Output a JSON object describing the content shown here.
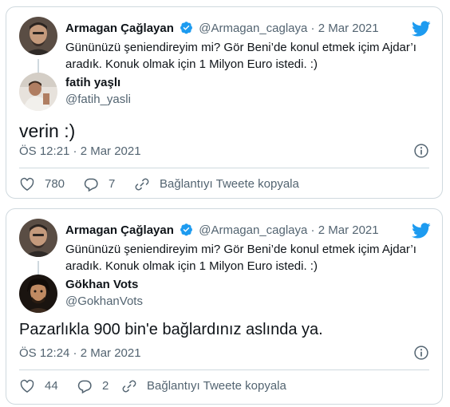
{
  "tweets": [
    {
      "original": {
        "name": "Armagan Çağlayan",
        "handle": "@Armagan_caglaya",
        "sep": "·",
        "date": "2 Mar 2021",
        "text": "Gününüzü şeniendireyim mi? Gör Beni’de konul etmek içim Ajdar’ı aradık. Konuk olmak için 1 Milyon Euro istedi. :)"
      },
      "reply": {
        "name": "fatih yaşlı",
        "handle": "@fatih_yasli",
        "text": "verin :)",
        "timestamp": "ÖS 12:21 · 2 Mar 2021"
      },
      "actions": {
        "likes": "780",
        "replies": "7",
        "copy_link": "Bağlantıyı Tweete kopyala"
      }
    },
    {
      "original": {
        "name": "Armagan Çağlayan",
        "handle": "@Armagan_caglaya",
        "sep": "·",
        "date": "2 Mar 2021",
        "text": "Gününüzü şeniendireyim mi? Gör Beni’de konul etmek içim Ajdar’ı aradık. Konuk olmak için 1 Milyon Euro istedi. :)"
      },
      "reply": {
        "name": "Gökhan Vots",
        "handle": "@GokhanVots",
        "text": "Pazarlıkla 900 bin'e bağlardınız aslında ya.",
        "timestamp": "ÖS 12:24 · 2 Mar 2021"
      },
      "actions": {
        "likes": "44",
        "replies": "2",
        "copy_link": "Bağlantıyı Tweete kopyala"
      }
    }
  ],
  "colors": {
    "accent": "#1d9bf0",
    "text": "#0f1419",
    "muted": "#536471",
    "border": "#cfd9de"
  },
  "icons": [
    "verified-badge-icon",
    "twitter-bird-icon",
    "info-icon",
    "heart-icon",
    "reply-bubble-icon",
    "link-icon"
  ]
}
